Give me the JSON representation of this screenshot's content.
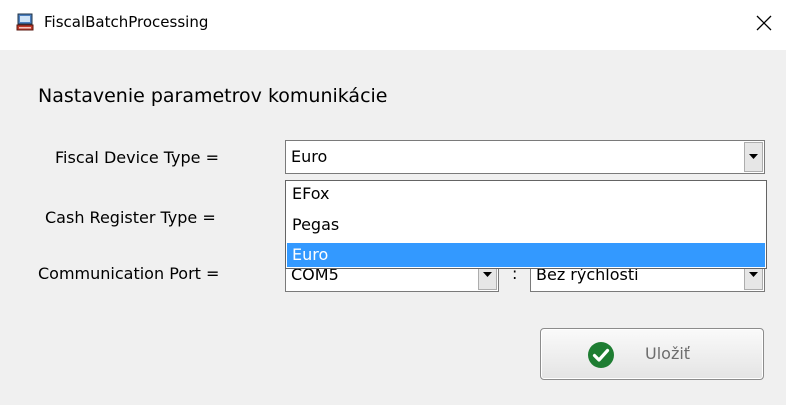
{
  "window": {
    "title": "FiscalBatchProcessing",
    "close_symbol": "✕"
  },
  "form": {
    "heading": "Nastavenie parametrov komunikácie",
    "fiscal_device_label": "Fiscal Device Type =",
    "fiscal_device_value": "Euro",
    "cash_register_label": "Cash Register Type =",
    "communication_port_label": "Communication Port =",
    "port_value": "COM5",
    "separator": ":",
    "speed_value": "Bez rýchlosti"
  },
  "dropdown": {
    "options": [
      "EFox",
      "Pegas",
      "Euro"
    ],
    "selected_index": 2
  },
  "save_button": {
    "label": "Uložiť"
  },
  "colors": {
    "selection": "#3399ff",
    "window_bg": "#f0f0f0",
    "save_icon": "#1e7d32"
  }
}
